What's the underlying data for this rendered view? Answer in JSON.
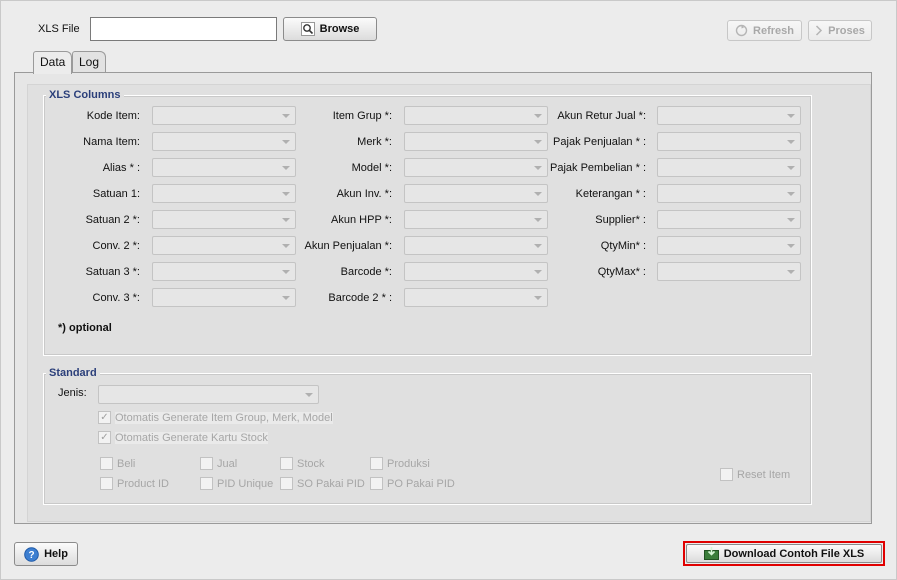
{
  "toolbar": {
    "xls_file_label": "XLS File",
    "xls_file_value": "",
    "browse_label": "Browse",
    "refresh_label": "Refresh",
    "proses_label": "Proses"
  },
  "tabs": [
    {
      "label": "Data",
      "active": true
    },
    {
      "label": "Log",
      "active": false
    }
  ],
  "xls_columns": {
    "title": "XLS Columns",
    "col1": [
      "Kode Item:",
      "Nama Item:",
      "Alias * :",
      "Satuan 1:",
      "Satuan 2 *:",
      "Conv. 2 *:",
      "Satuan 3 *:",
      "Conv. 3 *:"
    ],
    "col2": [
      "Item Grup *:",
      "Merk *:",
      "Model *:",
      "Akun Inv. *:",
      "Akun HPP *:",
      "Akun Penjualan *:",
      "Barcode *:",
      "Barcode 2 * :"
    ],
    "col3": [
      "Akun Retur Jual *:",
      "Pajak Penjualan * :",
      "Pajak Pembelian * :",
      "Keterangan * :",
      "Supplier* :",
      "QtyMin* :",
      "QtyMax* :"
    ],
    "optional_note": "*) optional"
  },
  "standard": {
    "title": "Standard",
    "jenis_label": "Jenis:",
    "auto_group": "Otomatis Generate Item Group, Merk, Model",
    "auto_kartu": "Otomatis Generate Kartu Stock",
    "row1": [
      "Beli",
      "Jual",
      "Stock",
      "Produksi"
    ],
    "row2": [
      "Product ID",
      "PID Unique",
      "SO Pakai PID",
      "PO Pakai PID"
    ],
    "reset_item": "Reset Item"
  },
  "footer": {
    "help_label": "Help",
    "download_label": "Download Contoh File XLS"
  },
  "colors": {
    "group_title": "#2b3f7a",
    "highlight": "#e00000"
  }
}
